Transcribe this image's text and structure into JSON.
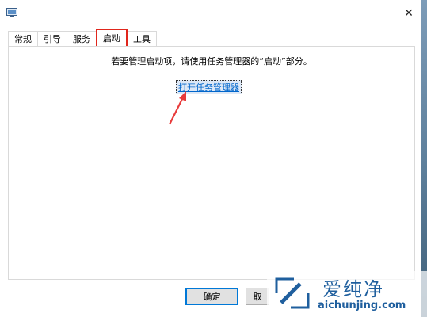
{
  "tabs": [
    {
      "label": "常规",
      "active": false
    },
    {
      "label": "引导",
      "active": false
    },
    {
      "label": "服务",
      "active": false
    },
    {
      "label": "启动",
      "active": true
    },
    {
      "label": "工具",
      "active": false
    }
  ],
  "startup": {
    "instruction": "若要管理启动项，请使用任务管理器的“启动”部分。",
    "link_label": "打开任务管理器"
  },
  "buttons": {
    "ok_label": "确定",
    "second_label": "取"
  },
  "titlebar": {
    "close_glyph": "✕"
  },
  "watermark": {
    "name": "爱纯净",
    "url": "aichunjing.com"
  },
  "colors": {
    "highlight_red": "#e0261c",
    "link_blue": "#0066cc",
    "focus_blue": "#0078d7"
  }
}
